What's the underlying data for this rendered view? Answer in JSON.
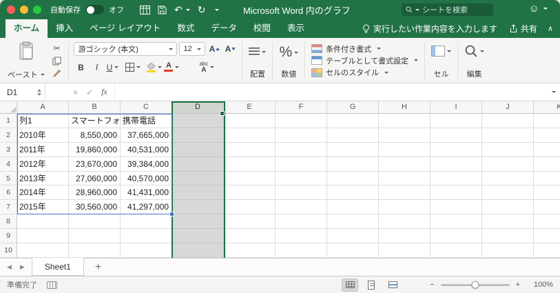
{
  "window": {
    "title": "Microsoft Word 内のグラフ"
  },
  "titlebar": {
    "autosave_label": "自動保存",
    "autosave_state": "オフ",
    "search_placeholder": "シートを検索"
  },
  "menu_tabs": [
    {
      "label": "ホーム",
      "active": true
    },
    {
      "label": "挿入",
      "active": false
    },
    {
      "label": "ページ レイアウト",
      "active": false
    },
    {
      "label": "数式",
      "active": false
    },
    {
      "label": "データ",
      "active": false
    },
    {
      "label": "校閲",
      "active": false
    },
    {
      "label": "表示",
      "active": false
    }
  ],
  "tab_bar_right": {
    "tell_me": "実行したい作業内容を入力します",
    "share": "共有"
  },
  "ribbon": {
    "paste_label": "ペースト",
    "font_name": "游ゴシック (本文)",
    "font_size": "12",
    "bold": "B",
    "italic": "I",
    "underline": "U",
    "grow_font": "A",
    "shrink_font": "A",
    "phonetic_top": "abc",
    "phonetic_bottom": "A",
    "align_label": "配置",
    "percent": "%",
    "number_label": "数値",
    "conditional_format": "条件付き書式",
    "format_as_table": "テーブルとして書式設定",
    "cell_styles": "セルのスタイル",
    "cells_label": "セル",
    "editing_label": "編集"
  },
  "formula_bar": {
    "name_box": "D1",
    "fx": "fx",
    "formula": ""
  },
  "grid": {
    "selected_column": "D",
    "columns": [
      "A",
      "B",
      "C",
      "D",
      "E",
      "F",
      "G",
      "H",
      "I",
      "J",
      "K"
    ],
    "rows": [
      "1",
      "2",
      "3",
      "4",
      "5",
      "6",
      "7",
      "8",
      "9",
      "10"
    ],
    "table": [
      [
        "列1",
        "スマートフォン",
        "携帯電話"
      ],
      [
        "2010年",
        "8,550,000",
        "37,665,000"
      ],
      [
        "2011年",
        "19,860,000",
        "40,531,000"
      ],
      [
        "2012年",
        "23,670,000",
        "39,384,000"
      ],
      [
        "2013年",
        "27,060,000",
        "40,570,000"
      ],
      [
        "2014年",
        "28,960,000",
        "41,431,000"
      ],
      [
        "2015年",
        "30,560,000",
        "41,297,000"
      ]
    ]
  },
  "sheet_bar": {
    "tabs": [
      {
        "name": "Sheet1",
        "active": true
      }
    ]
  },
  "status_bar": {
    "ready": "準備完了",
    "zoom": "100%"
  },
  "icons": {
    "undo": "↶",
    "redo": "↻",
    "collapse": "∧",
    "smiley": "☺",
    "prev": "◀",
    "next": "▶",
    "add": "+",
    "cancel": "×",
    "enter": "✓",
    "minus": "−",
    "plus": "+",
    "cut": "✂"
  },
  "colors": {
    "excel_green": "#217346",
    "range_blue": "#4472c4",
    "selection_gray": "#d8d8d8"
  }
}
